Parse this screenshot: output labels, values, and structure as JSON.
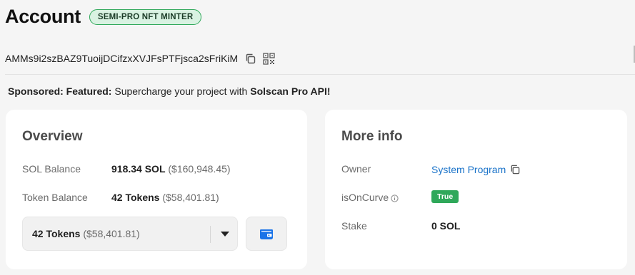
{
  "header": {
    "title": "Account",
    "badge": "SEMI-PRO NFT MINTER"
  },
  "address": {
    "value": "AMMs9i2szBAZ9TuoijDCifzxXVJFsPTFjsca2sFriKiM",
    "copy_icon": "copy-icon",
    "qr_icon": "qr-code-icon"
  },
  "sponsored": {
    "prefix": "Sponsored: Featured:",
    "text": "Supercharge your project with",
    "highlight": "Solscan Pro API!"
  },
  "overview": {
    "title": "Overview",
    "sol_balance_label": "SOL Balance",
    "sol_balance_value": "918.34 SOL",
    "sol_balance_usd": "($160,948.45)",
    "token_balance_label": "Token Balance",
    "token_balance_value": "42 Tokens",
    "token_balance_usd": "($58,401.81)",
    "token_select": {
      "value": "42 Tokens",
      "usd": "($58,401.81)"
    },
    "wallet_icon": "wallet-icon"
  },
  "more_info": {
    "title": "More info",
    "owner_label": "Owner",
    "owner_value": "System Program",
    "is_on_curve_label": "isOnCurve",
    "is_on_curve_value": "True",
    "stake_label": "Stake",
    "stake_value": "0 SOL"
  },
  "colors": {
    "badge_border": "#2fa85a",
    "badge_bg": "#d9f2e2",
    "link": "#1a73c9",
    "true_badge": "#2fa85a",
    "wallet_icon": "#1a73e8"
  }
}
